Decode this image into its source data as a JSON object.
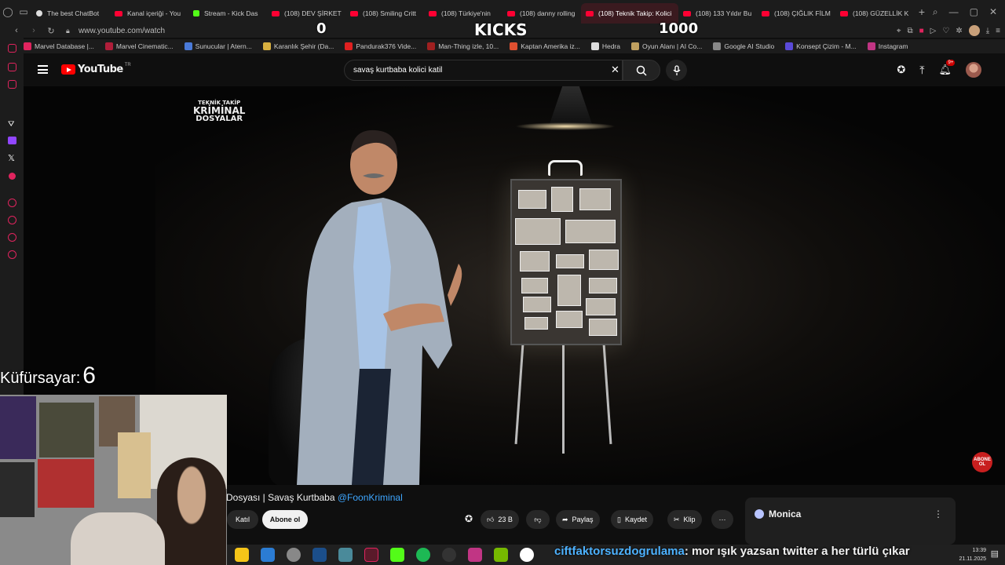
{
  "browser": {
    "tabs": [
      {
        "label": "The best ChatBot",
        "icon": "white"
      },
      {
        "label": "Kanal içeriği - You",
        "icon": "red"
      },
      {
        "label": "Stream - Kick Das",
        "icon": "green"
      },
      {
        "label": "(108) DEV ŞİRKET",
        "icon": "red"
      },
      {
        "label": "(108) Smiling Critt",
        "icon": "red"
      },
      {
        "label": "(108) Türkiye'nin",
        "icon": "red"
      },
      {
        "label": "(108) danny rolling",
        "icon": "red"
      },
      {
        "label": "(108) Teknik Takip: Kolici",
        "icon": "red",
        "active": true
      },
      {
        "label": "(108) 133 Yıldır Bu",
        "icon": "red"
      },
      {
        "label": "(108) ÇIĞLIK FİLM",
        "icon": "red"
      },
      {
        "label": "(108) GÜZELLİK K",
        "icon": "red"
      }
    ],
    "url": "www.youtube.com/watch",
    "bookmarks": [
      "Marvel Database |...",
      "Marvel Cinematic...",
      "Sunucular | Atern...",
      "Karanlık Şehir (Da...",
      "Pandurak376 Vide...",
      "Man-Thing izle, 10...",
      "Kaptan Amerika iz...",
      "Hedra",
      "Oyun Alanı | AI Co...",
      "Google AI Studio",
      "Konsept Çizim - M...",
      "Instagram"
    ]
  },
  "overlay": {
    "counter_left": "0",
    "kicks_label": "KICKS",
    "counter_right": "1000",
    "swear_label": "Küfürsayar:",
    "swear_count": "6"
  },
  "youtube": {
    "logo_text": "YouTube",
    "country": "TR",
    "search_value": "savaş kurtbaba kolici katil",
    "notif_badge": "9+"
  },
  "video": {
    "logo_line1": "TEKNİK TAKİP",
    "logo_line2": "KRİMİNAL",
    "logo_line3": "DOSYALAR",
    "subscribe_corner_1": "ABONE",
    "subscribe_corner_2": "OL",
    "title_visible": "Dosyası | Savaş Kurtbaba ",
    "channel_handle": "@FoonKriminal",
    "join_label": "Katıl",
    "subscribe_label": "Abone ol",
    "like_count": "23 B",
    "share_label": "Paylaş",
    "save_label": "Kaydet",
    "clip_label": "Klip"
  },
  "monica": {
    "title": "Monica"
  },
  "chat": {
    "user": "ciftfaktorsuzdogrulama",
    "message": ": mor ışık yazsan twitter a her türlü çıkar"
  },
  "clock": {
    "time": "13:39",
    "date": "21.11.2025"
  }
}
